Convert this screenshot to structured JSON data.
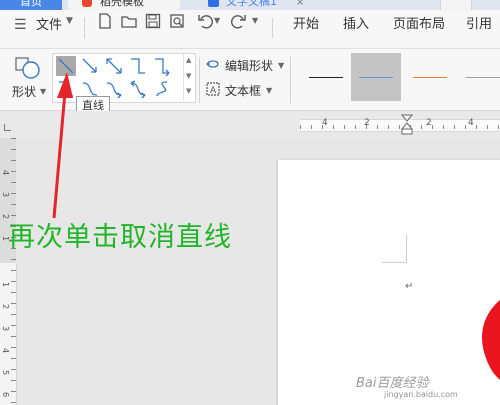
{
  "tabs": {
    "home": "首页",
    "templates": "稻壳模板",
    "document": "文字文稿1"
  },
  "menubar": {
    "file_label": "文件",
    "items": [
      "开始",
      "插入",
      "页面布局",
      "引用"
    ]
  },
  "ribbon": {
    "shape_label": "形状",
    "edit_shape_label": "编辑形状",
    "textbox_label": "文本框",
    "tooltip": "直线"
  },
  "rulers": {
    "h_ticks": [
      "4",
      "2",
      "2",
      "4"
    ],
    "v_ticks": [
      "4",
      "3",
      "2",
      "1",
      "1",
      "2",
      "3",
      "4",
      "5",
      "6"
    ]
  },
  "document": {
    "paragraph_mark": "↵"
  },
  "annotation": {
    "text": "再次单击取消直线"
  },
  "watermark": {
    "main": "Bai百度经验",
    "sub": "jingyan.baidu.com"
  },
  "colors": {
    "accent_blue": "#4a86e8",
    "annotation_green": "#22b52a",
    "arrow_red": "#e3262a",
    "heart_red": "#e8141e",
    "line_orange": "#e8823a",
    "line_blue": "#5b9bd5"
  }
}
